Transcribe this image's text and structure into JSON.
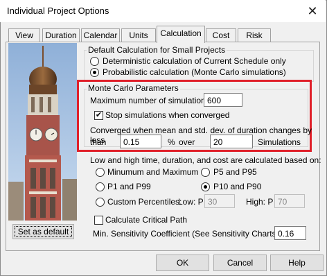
{
  "window": {
    "title": "Individual Project Options",
    "close_glyph": "✕"
  },
  "tabs": [
    "View",
    "Duration",
    "Calendar",
    "Units",
    "Calculation",
    "Cost",
    "Risk"
  ],
  "active_tab": "Calculation",
  "default_calc": {
    "legend": "Default Calculation for Small Projects",
    "opt_deterministic": "Deterministic calculation of Current Schedule only",
    "opt_probabilistic": "Probabilistic calculation (Monte Carlo simulations)",
    "selected": "probabilistic"
  },
  "monte_carlo": {
    "legend": "Monte Carlo Parameters",
    "max_sims_label": "Maximum number of simulations:",
    "max_sims_value": "600",
    "stop_label": "Stop simulations when converged",
    "stop_checked": true,
    "converged_label": "Converged when mean and std. dev. of duration changes by less",
    "than_label": "than",
    "than_value": "0.15",
    "percent_label": "%",
    "over_label": "over",
    "over_value": "20",
    "sims_label": "Simulations"
  },
  "range": {
    "label": "Low and high time, duration, and cost are calculated based on:",
    "opt_minmax": "Minumum and Maximum",
    "opt_p5": "P5 and P95",
    "opt_p1": "P1 and P99",
    "opt_p10": "P10 and P90",
    "opt_custom": "Custom Percentiles:",
    "selected": "p10",
    "low_label": "Low: P",
    "low_value": "30",
    "high_label": "High: P",
    "high_value": "70"
  },
  "critical_path_label": "Calculate Critical Path",
  "sensitivity_label": "Min. Sensitivity Coefficient (See Sensitivity Charts):",
  "sensitivity_value": "0.16",
  "set_default_label": "Set as default",
  "buttons": {
    "ok": "OK",
    "cancel": "Cancel",
    "help": "Help"
  }
}
